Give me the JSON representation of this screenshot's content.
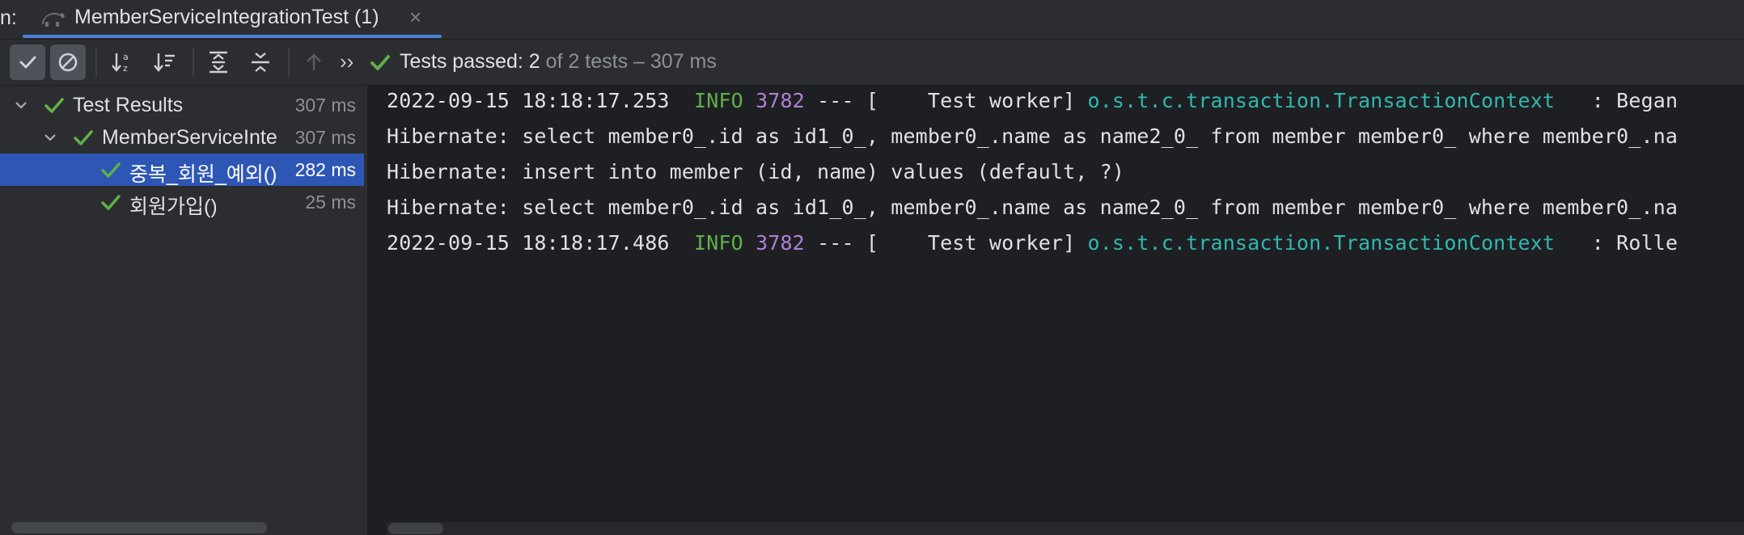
{
  "window": {
    "run_prefix": "n:",
    "tab_title": "MemberServiceIntegrationTest (1)",
    "tab_close": "×",
    "tab_icon": "gradle-icon"
  },
  "toolbar": {
    "buttons": [
      {
        "icon": "show-passed-icon",
        "active": true
      },
      {
        "icon": "show-ignored-icon",
        "active": true
      },
      {
        "icon": "sort-alphabetically-icon",
        "active": false
      },
      {
        "icon": "sort-by-duration-icon",
        "active": false
      },
      {
        "icon": "expand-all-icon",
        "active": false
      },
      {
        "icon": "collapse-all-icon",
        "active": false
      },
      {
        "icon": "previous-failed-icon",
        "active": false
      }
    ],
    "more_label": "››",
    "status_label": "Tests passed: 2",
    "status_detail": " of 2 tests – 307 ms"
  },
  "tree": {
    "rows": [
      {
        "label": "Test Results",
        "time": "307 ms",
        "selected": false
      },
      {
        "label": "MemberServiceInte",
        "time": "307 ms",
        "selected": false
      },
      {
        "label": "중복_회원_예외()",
        "time": "282 ms",
        "selected": true
      },
      {
        "label": "회원가입()",
        "time": "25 ms",
        "selected": false
      }
    ]
  },
  "console": {
    "line1": {
      "timestamp": "2022-09-15 18:18:17.253",
      "level": "INFO",
      "pid": "3782",
      "thread": "--- [    Test worker]",
      "logger": "o.s.t.c.transaction.TransactionContext",
      "message": "  : Began"
    },
    "line2": "Hibernate: select member0_.id as id1_0_, member0_.name as name2_0_ from member member0_ where member0_.na",
    "line3": "Hibernate: insert into member (id, name) values (default, ?)",
    "line4": "Hibernate: select member0_.id as id1_0_, member0_.name as name2_0_ from member member0_ where member0_.na",
    "line5": {
      "timestamp": "2022-09-15 18:18:17.486",
      "level": "INFO",
      "pid": "3782",
      "thread": "--- [    Test worker]",
      "logger": "o.s.t.c.transaction.TransactionContext",
      "message": "  : Rolle"
    }
  },
  "colors": {
    "passed_green": "#5fb049",
    "selection_blue": "#2e56b5",
    "tab_underline": "#4d82d6",
    "log_level": "#5fb049",
    "log_pid": "#b07fd6",
    "log_logger": "#2fb8b0"
  }
}
